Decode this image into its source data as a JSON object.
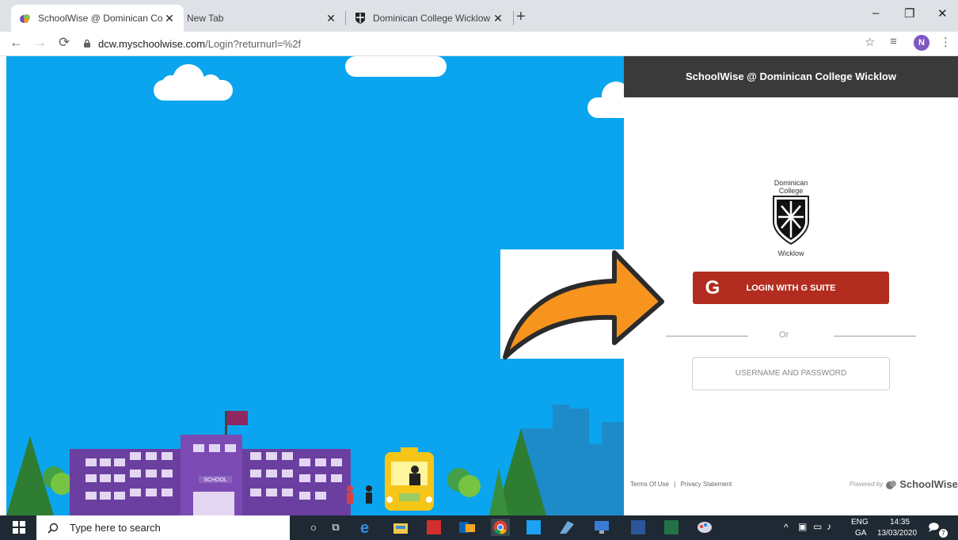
{
  "browser": {
    "tabs": [
      {
        "title": "SchoolWise @ Dominican Colleg",
        "close": "✕"
      },
      {
        "title": "New Tab",
        "close": "✕"
      },
      {
        "title": "Dominican College Wicklow",
        "close": "✕"
      }
    ],
    "new_tab": "+",
    "window_controls": {
      "minimize": "–",
      "restore": "❐",
      "close": "✕"
    },
    "url_host": "dcw.myschoolwise.com",
    "url_path": "/Login?returnurl=%2f",
    "profile_initial": "N"
  },
  "page": {
    "header_title": "SchoolWise @ Dominican College Wicklow",
    "logo": {
      "top": "Dominican",
      "mid": "College",
      "bottom": "Wicklow"
    },
    "school_sign": "SCHOOL",
    "gsuite_label": "LOGIN WITH G SUITE",
    "or_label": "Or",
    "userpass_label": "USERNAME AND PASSWORD",
    "footer": {
      "terms": "Terms Of Use",
      "sep": "|",
      "privacy": "Privacy Statement"
    },
    "powered_by": "Powered by",
    "brand": "SchoolWise"
  },
  "taskbar": {
    "search_placeholder": "Type here to search",
    "lang_top": "ENG",
    "lang_bottom": "GA",
    "time": "14:35",
    "date": "13/03/2020",
    "notification_count": "7"
  },
  "colors": {
    "sky": "#0aa5ee",
    "header": "#3a3a3a",
    "gsuite": "#b22d1f",
    "arrow": "#f7941d"
  }
}
